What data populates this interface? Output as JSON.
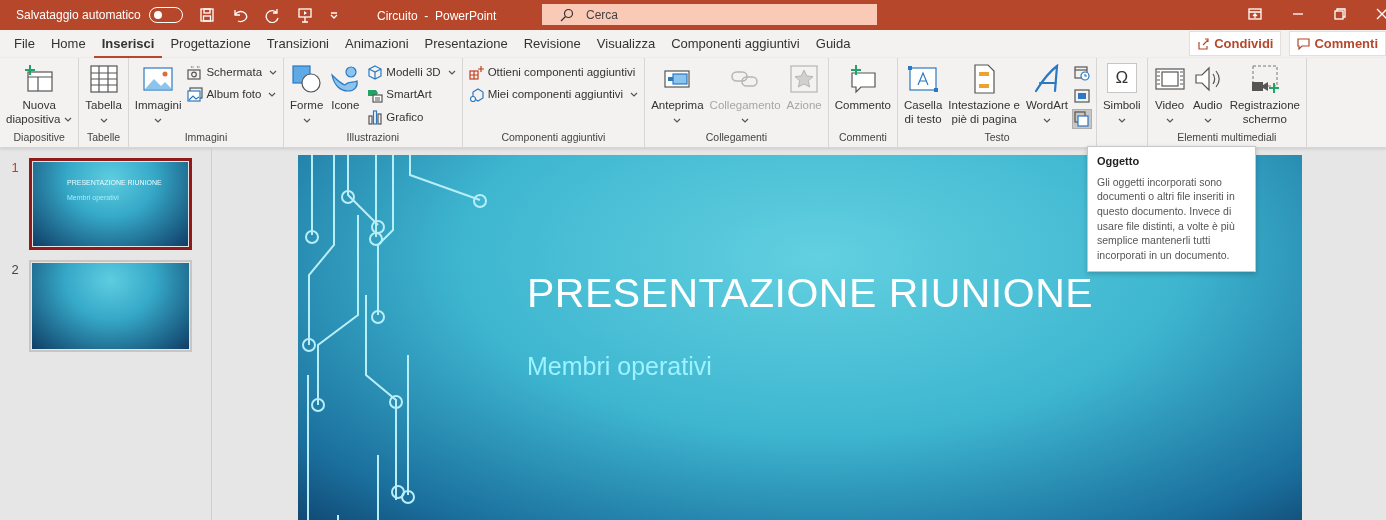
{
  "title_bar": {
    "autosave_label": "Salvataggio automatico",
    "autosave_on": false,
    "title": "Circuito  -  PowerPoint",
    "search_placeholder": "Cerca"
  },
  "tabs": [
    {
      "label": "File",
      "selected": false
    },
    {
      "label": "Home",
      "selected": false
    },
    {
      "label": "Inserisci",
      "selected": true
    },
    {
      "label": "Progettazione",
      "selected": false
    },
    {
      "label": "Transizioni",
      "selected": false
    },
    {
      "label": "Animazioni",
      "selected": false
    },
    {
      "label": "Presentazione",
      "selected": false
    },
    {
      "label": "Revisione",
      "selected": false
    },
    {
      "label": "Visualizza",
      "selected": false
    },
    {
      "label": "Componenti aggiuntivi",
      "selected": false
    },
    {
      "label": "Guida",
      "selected": false
    }
  ],
  "share_button": "Condividi",
  "comments_button": "Commenti",
  "ribbon_groups": [
    {
      "label": "Diapositive",
      "items": [
        {
          "kind": "large",
          "lines": [
            "Nuova",
            "diapositiva"
          ],
          "dropdown": true,
          "disabled": false
        }
      ]
    },
    {
      "label": "Tabelle",
      "items": [
        {
          "kind": "large",
          "lines": [
            "Tabella"
          ],
          "dropdown": true,
          "disabled": false
        }
      ]
    },
    {
      "label": "Immagini",
      "items": [
        {
          "kind": "large",
          "lines": [
            "Immagini"
          ],
          "dropdown": true,
          "disabled": false
        },
        {
          "kind": "small",
          "label": "Schermata",
          "dropdown": true,
          "disabled": false
        },
        {
          "kind": "small",
          "label": "Album foto",
          "dropdown": true,
          "disabled": false
        }
      ]
    },
    {
      "label": "Illustrazioni",
      "items": [
        {
          "kind": "large",
          "lines": [
            "Forme"
          ],
          "dropdown": true,
          "disabled": false
        },
        {
          "kind": "large",
          "lines": [
            "Icone"
          ],
          "dropdown": false,
          "disabled": false
        },
        {
          "kind": "small",
          "label": "Modelli 3D",
          "dropdown": true,
          "disabled": false
        },
        {
          "kind": "small",
          "label": "SmartArt",
          "dropdown": false,
          "disabled": false
        },
        {
          "kind": "small",
          "label": "Grafico",
          "dropdown": false,
          "disabled": false
        }
      ]
    },
    {
      "label": "Componenti aggiuntivi",
      "items": [
        {
          "kind": "small",
          "label": "Ottieni componenti aggiuntivi",
          "dropdown": false,
          "disabled": false
        },
        {
          "kind": "small",
          "label": "Miei componenti aggiuntivi",
          "dropdown": true,
          "disabled": false
        }
      ]
    },
    {
      "label": "Collegamenti",
      "items": [
        {
          "kind": "large",
          "lines": [
            "Anteprima"
          ],
          "dropdown": true,
          "disabled": false
        },
        {
          "kind": "large",
          "lines": [
            "Collegamento"
          ],
          "dropdown": true,
          "disabled": true
        },
        {
          "kind": "large",
          "lines": [
            "Azione"
          ],
          "dropdown": false,
          "disabled": true
        }
      ]
    },
    {
      "label": "Commenti",
      "items": [
        {
          "kind": "large",
          "lines": [
            "Commento"
          ],
          "dropdown": false,
          "disabled": false
        }
      ]
    },
    {
      "label": "Testo",
      "items": [
        {
          "kind": "large",
          "lines": [
            "Casella",
            "di testo"
          ],
          "dropdown": false,
          "disabled": false
        },
        {
          "kind": "large",
          "lines": [
            "Intestazione e",
            "piè di pagina"
          ],
          "dropdown": false,
          "disabled": false
        },
        {
          "kind": "large",
          "lines": [
            "WordArt"
          ],
          "dropdown": true,
          "disabled": false
        },
        {
          "kind": "icon",
          "highlighted": false
        },
        {
          "kind": "icon",
          "highlighted": false
        },
        {
          "kind": "icon",
          "highlighted": true
        }
      ]
    },
    {
      "items": [
        {
          "kind": "large",
          "glyph": "Ω",
          "lines": [
            "Simboli"
          ],
          "dropdown": true,
          "disabled": false
        }
      ]
    },
    {
      "label": "Elementi multimediali",
      "items": [
        {
          "kind": "large",
          "lines": [
            "Video"
          ],
          "dropdown": true,
          "disabled": false
        },
        {
          "kind": "large",
          "lines": [
            "Audio"
          ],
          "dropdown": true,
          "disabled": false
        },
        {
          "kind": "large",
          "lines": [
            "Registrazione",
            "schermo"
          ],
          "dropdown": false,
          "disabled": false
        }
      ]
    }
  ],
  "tooltip": {
    "title": "Oggetto",
    "text": "Gli oggetti incorporati sono documenti o altri file inseriti in questo documento. Invece di usare file distinti, a volte è più semplice mantenerli tutti incorporati in un documento."
  },
  "slides": [
    {
      "number": "1",
      "selected": true,
      "title": "PRESENTAZIONE RIUNIONE",
      "subtitle": "Membri operativi"
    },
    {
      "number": "2",
      "selected": false
    }
  ],
  "current_slide": {
    "title": "PRESENTAZIONE RIUNIONE",
    "subtitle": "Membri operativi"
  }
}
